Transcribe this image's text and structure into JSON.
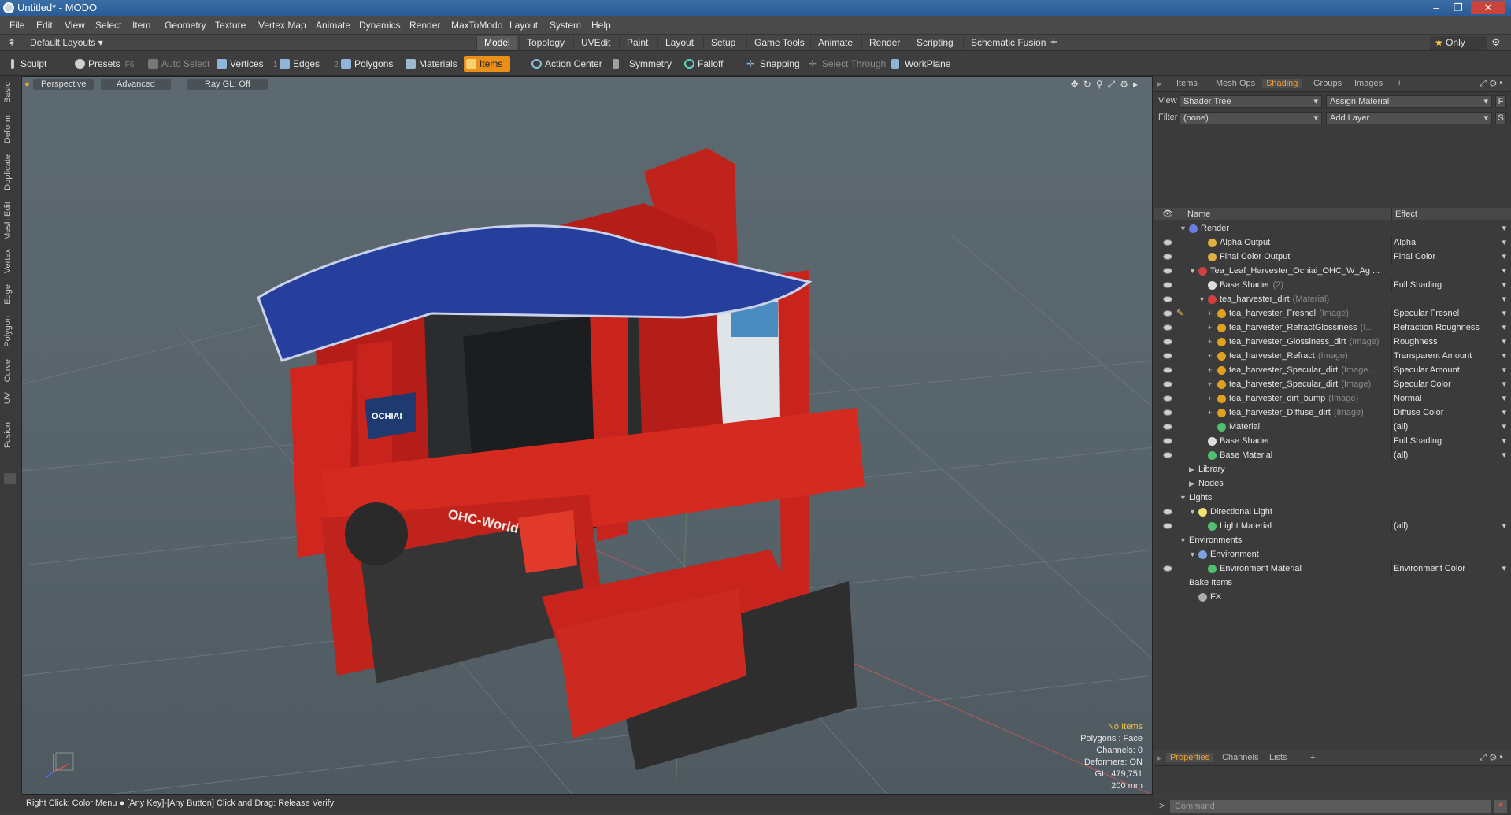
{
  "titlebar": {
    "title": "Untitled* - MODO",
    "min": "–",
    "max": "❐",
    "close": "✕"
  },
  "menu": [
    "File",
    "Edit",
    "View",
    "Select",
    "Item",
    "Geometry",
    "Texture",
    "Vertex Map",
    "Animate",
    "Dynamics",
    "Render",
    "MaxToModo",
    "Layout",
    "System",
    "Help"
  ],
  "layout_menu": "Default Layouts ▾",
  "tabs": [
    "Model",
    "Topology",
    "UVEdit",
    "Paint",
    "Layout",
    "Setup",
    "Game Tools",
    "Animate",
    "Render",
    "Scripting",
    "Schematic Fusion"
  ],
  "active_tab": "Model",
  "tab_plus": "+",
  "only_label": "Only",
  "toolbar": {
    "sculpt": "Sculpt",
    "presets": "Presets",
    "presets_key": "F6",
    "auto_select": "Auto Select",
    "vertices": "Vertices",
    "vertices_key": "1",
    "edges": "Edges",
    "edges_key": "2",
    "polygons": "Polygons",
    "materials": "Materials",
    "items": "Items",
    "action_center": "Action Center",
    "symmetry": "Symmetry",
    "falloff": "Falloff",
    "snapping": "Snapping",
    "select_through": "Select Through",
    "workplane": "WorkPlane"
  },
  "left_tabs": [
    "Basic",
    "Deform",
    "Duplicate",
    "Mesh Edit",
    "Vertex",
    "Edge",
    "Polygon",
    "Curve",
    "UV",
    "Fusion"
  ],
  "viewport": {
    "perspective": "Perspective",
    "advanced": "Advanced",
    "raygl": "Ray GL: Off",
    "model_labels": {
      "ochiai": "OCHIAI",
      "ohc_world": "OHC-World"
    },
    "stats": {
      "no_items": "No Items",
      "polygons": "Polygons : Face",
      "channels": "Channels: 0",
      "deformers": "Deformers: ON",
      "gl": "GL: 479,751",
      "scale": "200 mm"
    }
  },
  "panel": {
    "tabs": [
      "Items",
      "Mesh Ops",
      "Shading",
      "Groups",
      "Images"
    ],
    "active": "Shading",
    "plus": "+",
    "view_label": "View",
    "view_value": "Shader Tree",
    "assign_material": "Assign Material",
    "f_btn": "F",
    "filter_label": "Filter",
    "filter_value": "(none)",
    "add_layer": "Add Layer",
    "s_btn": "S",
    "col_name": "Name",
    "col_effect": "Effect"
  },
  "tree": [
    {
      "name": "Render",
      "sub": "",
      "effect": "",
      "indent": 0,
      "arrow": "▼",
      "icon": "#6a7de0",
      "eye": false
    },
    {
      "name": "Alpha Output",
      "sub": "",
      "effect": "Alpha",
      "indent": 2,
      "arrow": "",
      "icon": "#e0b040",
      "eye": true
    },
    {
      "name": "Final Color Output",
      "sub": "",
      "effect": "Final Color",
      "indent": 2,
      "arrow": "",
      "icon": "#e0b040",
      "eye": true
    },
    {
      "name": "Tea_Leaf_Harvester_Ochiai_OHC_W_Ag ...",
      "sub": "",
      "effect": "",
      "indent": 1,
      "arrow": "▼",
      "icon": "#d04040",
      "eye": true
    },
    {
      "name": "Base Shader",
      "sub": "(2)",
      "effect": "Full Shading",
      "indent": 2,
      "arrow": "",
      "icon": "#dddddd",
      "eye": true
    },
    {
      "name": "tea_harvester_dirt",
      "sub": "(Material)",
      "effect": "",
      "indent": 2,
      "arrow": "▼",
      "icon": "#d04040",
      "eye": true
    },
    {
      "name": "tea_harvester_Fresnel",
      "sub": "(Image)",
      "effect": "Specular Fresnel",
      "indent": 3,
      "arrow": "+",
      "icon": "#e0a020",
      "eye": true,
      "brush": true
    },
    {
      "name": "tea_harvester_RefractGlossiness",
      "sub": "(I...",
      "effect": "Refraction Roughness",
      "indent": 3,
      "arrow": "+",
      "icon": "#e0a020",
      "eye": true
    },
    {
      "name": "tea_harvester_Glossiness_dirt",
      "sub": "(Image)",
      "effect": "Roughness",
      "indent": 3,
      "arrow": "+",
      "icon": "#e0a020",
      "eye": true
    },
    {
      "name": "tea_harvester_Refract",
      "sub": "(Image)",
      "effect": "Transparent Amount",
      "indent": 3,
      "arrow": "+",
      "icon": "#e0a020",
      "eye": true
    },
    {
      "name": "tea_harvester_Specular_dirt",
      "sub": "(Image...",
      "effect": "Specular Amount",
      "indent": 3,
      "arrow": "+",
      "icon": "#e0a020",
      "eye": true
    },
    {
      "name": "tea_harvester_Specular_dirt",
      "sub": "(Image)",
      "effect": "Specular Color",
      "indent": 3,
      "arrow": "+",
      "icon": "#e0a020",
      "eye": true
    },
    {
      "name": "tea_harvester_dirt_bump",
      "sub": "(Image)",
      "effect": "Normal",
      "indent": 3,
      "arrow": "+",
      "icon": "#e0a020",
      "eye": true
    },
    {
      "name": "tea_harvester_Diffuse_dirt",
      "sub": "(Image)",
      "effect": "Diffuse Color",
      "indent": 3,
      "arrow": "+",
      "icon": "#e0a020",
      "eye": true
    },
    {
      "name": "Material",
      "sub": "",
      "effect": "(all)",
      "indent": 3,
      "arrow": "",
      "icon": "#50c070",
      "eye": true
    },
    {
      "name": "Base Shader",
      "sub": "",
      "effect": "Full Shading",
      "indent": 2,
      "arrow": "",
      "icon": "#dddddd",
      "eye": true
    },
    {
      "name": "Base Material",
      "sub": "",
      "effect": "(all)",
      "indent": 2,
      "arrow": "",
      "icon": "#50c070",
      "eye": true
    },
    {
      "name": "Library",
      "sub": "",
      "effect": "",
      "indent": 1,
      "arrow": "▶",
      "icon": "",
      "eye": false,
      "noeff": true
    },
    {
      "name": "Nodes",
      "sub": "",
      "effect": "",
      "indent": 1,
      "arrow": "▶",
      "icon": "",
      "eye": false,
      "noeff": true
    },
    {
      "name": "Lights",
      "sub": "",
      "effect": "",
      "indent": 0,
      "arrow": "▼",
      "icon": "",
      "eye": false,
      "noeff": true
    },
    {
      "name": "Directional Light",
      "sub": "",
      "effect": "",
      "indent": 1,
      "arrow": "▼",
      "icon": "#f0e070",
      "eye": true,
      "noeff": true
    },
    {
      "name": "Light Material",
      "sub": "",
      "effect": "(all)",
      "indent": 2,
      "arrow": "",
      "icon": "#50c070",
      "eye": true
    },
    {
      "name": "Environments",
      "sub": "",
      "effect": "",
      "indent": 0,
      "arrow": "▼",
      "icon": "",
      "eye": false,
      "noeff": true
    },
    {
      "name": "Environment",
      "sub": "",
      "effect": "",
      "indent": 1,
      "arrow": "▼",
      "icon": "#80a0e0",
      "eye": false,
      "noeff": true
    },
    {
      "name": "Environment Material",
      "sub": "",
      "effect": "Environment Color",
      "indent": 2,
      "arrow": "",
      "icon": "#50c070",
      "eye": true
    },
    {
      "name": "Bake Items",
      "sub": "",
      "effect": "",
      "indent": 0,
      "arrow": "",
      "icon": "",
      "eye": false,
      "noeff": true
    },
    {
      "name": "FX",
      "sub": "",
      "effect": "",
      "indent": 1,
      "arrow": "",
      "icon": "#aaaaaa",
      "eye": false,
      "noeff": true
    }
  ],
  "bottom_tabs": [
    "Properties",
    "Channels",
    "Lists"
  ],
  "bottom_active": "Properties",
  "command_placeholder": "Command",
  "statusbar": "Right Click: Color Menu ● [Any Key]-[Any Button] Click and Drag: Release Verify"
}
